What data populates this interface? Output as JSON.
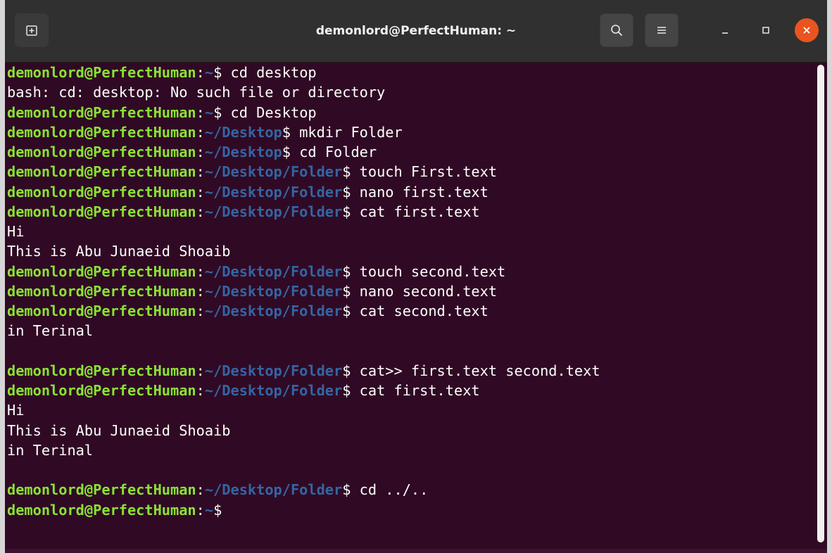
{
  "window": {
    "title": "demonlord@PerfectHuman: ~"
  },
  "titlebar": {
    "new_tab_icon": "new-tab-icon",
    "search_icon": "search-icon",
    "menu_icon": "hamburger-menu-icon",
    "minimize_icon": "minimize-icon",
    "maximize_icon": "maximize-icon",
    "close_icon": "close-icon",
    "close_color": "#e95420"
  },
  "colors": {
    "background": "#300a24",
    "user_host": "#8ae234",
    "path": "#3465a4",
    "text": "#ffffff"
  },
  "terminal": {
    "lines": [
      {
        "type": "prompt",
        "user": "demonlord@PerfectHuman",
        "path": "~",
        "command": " cd desktop"
      },
      {
        "type": "output",
        "text": "bash: cd: desktop: No such file or directory"
      },
      {
        "type": "prompt",
        "user": "demonlord@PerfectHuman",
        "path": "~",
        "command": " cd Desktop"
      },
      {
        "type": "prompt",
        "user": "demonlord@PerfectHuman",
        "path": "~/Desktop",
        "command": " mkdir Folder"
      },
      {
        "type": "prompt",
        "user": "demonlord@PerfectHuman",
        "path": "~/Desktop",
        "command": " cd Folder"
      },
      {
        "type": "prompt",
        "user": "demonlord@PerfectHuman",
        "path": "~/Desktop/Folder",
        "command": " touch First.text"
      },
      {
        "type": "prompt",
        "user": "demonlord@PerfectHuman",
        "path": "~/Desktop/Folder",
        "command": " nano first.text"
      },
      {
        "type": "prompt",
        "user": "demonlord@PerfectHuman",
        "path": "~/Desktop/Folder",
        "command": " cat first.text"
      },
      {
        "type": "output",
        "text": "Hi"
      },
      {
        "type": "output",
        "text": "This is Abu Junaeid Shoaib"
      },
      {
        "type": "prompt",
        "user": "demonlord@PerfectHuman",
        "path": "~/Desktop/Folder",
        "command": " touch second.text"
      },
      {
        "type": "prompt",
        "user": "demonlord@PerfectHuman",
        "path": "~/Desktop/Folder",
        "command": " nano second.text"
      },
      {
        "type": "prompt",
        "user": "demonlord@PerfectHuman",
        "path": "~/Desktop/Folder",
        "command": " cat second.text"
      },
      {
        "type": "output",
        "text": "in Terinal"
      },
      {
        "type": "output",
        "text": ""
      },
      {
        "type": "prompt",
        "user": "demonlord@PerfectHuman",
        "path": "~/Desktop/Folder",
        "command": " cat>> first.text second.text"
      },
      {
        "type": "prompt",
        "user": "demonlord@PerfectHuman",
        "path": "~/Desktop/Folder",
        "command": " cat first.text"
      },
      {
        "type": "output",
        "text": "Hi"
      },
      {
        "type": "output",
        "text": "This is Abu Junaeid Shoaib"
      },
      {
        "type": "output",
        "text": "in Terinal"
      },
      {
        "type": "output",
        "text": ""
      },
      {
        "type": "prompt",
        "user": "demonlord@PerfectHuman",
        "path": "~/Desktop/Folder",
        "command": " cd ../.."
      },
      {
        "type": "prompt",
        "user": "demonlord@PerfectHuman",
        "path": "~",
        "command": ""
      }
    ]
  }
}
